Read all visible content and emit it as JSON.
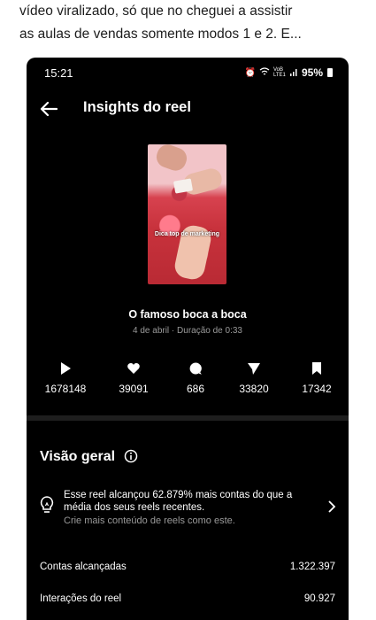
{
  "caption": {
    "lines": [
      "vídeo viralizado, só que no cheguei a assistir",
      "as aulas de vendas somente modos 1 e 2. E..."
    ]
  },
  "status_bar": {
    "time": "15:21",
    "network": "VoB LTE1",
    "battery": "95%"
  },
  "header": {
    "title": "Insights do reel"
  },
  "reel": {
    "thumbnail_text": "Dica top de marketing",
    "title": "O famoso boca a boca",
    "meta": "4 de abril · Duração de 0:33"
  },
  "stats": [
    {
      "icon": "play-icon",
      "value": "1678148"
    },
    {
      "icon": "heart-icon",
      "value": "39091"
    },
    {
      "icon": "comment-icon",
      "value": "686"
    },
    {
      "icon": "share-icon",
      "value": "33820"
    },
    {
      "icon": "bookmark-icon",
      "value": "17342"
    }
  ],
  "overview": {
    "title": "Visão geral",
    "insight_text": "Esse reel alcançou 62.879% mais contas do que a média dos seus reels recentes.",
    "insight_sub": "Crie mais conteúdo de reels como este.",
    "rows": [
      {
        "label": "Contas alcançadas",
        "value": "1.322.397"
      },
      {
        "label": "Interações do reel",
        "value": "90.927"
      }
    ]
  }
}
